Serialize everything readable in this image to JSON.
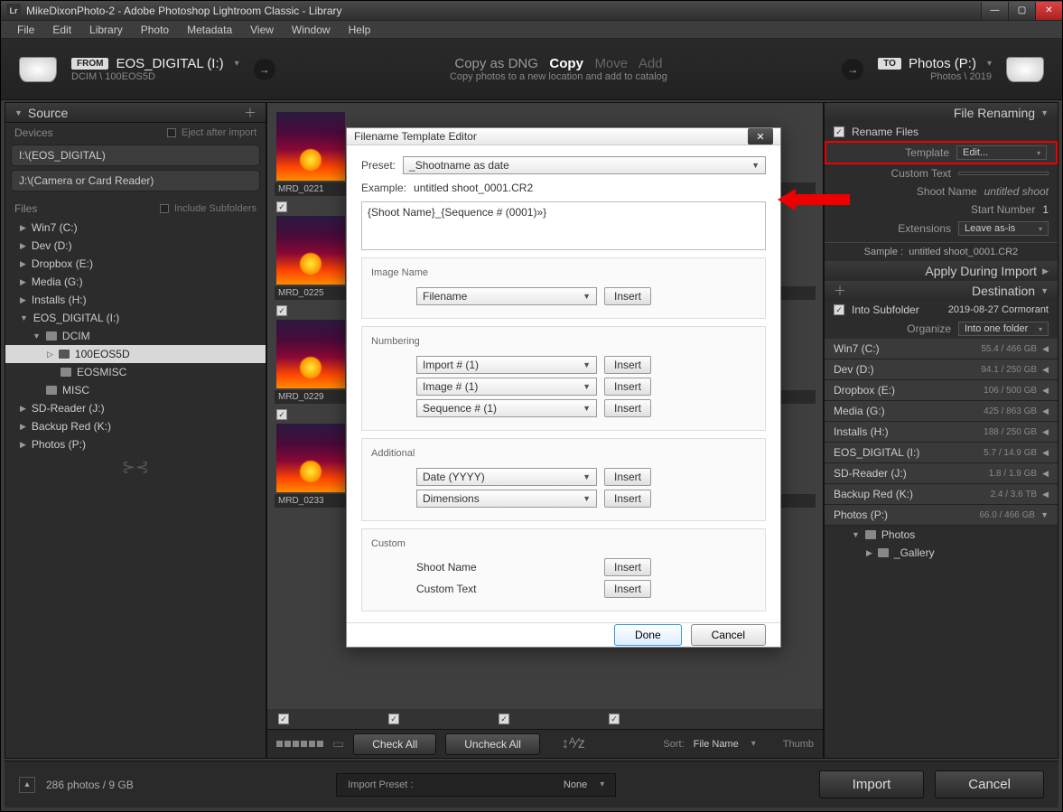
{
  "window": {
    "title": "MikeDixonPhoto-2 - Adobe Photoshop Lightroom Classic - Library",
    "icon_label": "Lr"
  },
  "menu": [
    "File",
    "Edit",
    "Library",
    "Photo",
    "Metadata",
    "View",
    "Window",
    "Help"
  ],
  "importbar": {
    "from_badge": "FROM",
    "from_main": "EOS_DIGITAL (I:)",
    "from_sub": "DCIM \\ 100EOS5D",
    "modes": {
      "dng": "Copy as DNG",
      "copy": "Copy",
      "move": "Move",
      "add": "Add"
    },
    "sub": "Copy photos to a new location and add to catalog",
    "to_badge": "TO",
    "to_main": "Photos (P:)",
    "to_sub": "Photos \\ 2019"
  },
  "source": {
    "header": "Source",
    "devices_label": "Devices",
    "eject": "Eject after import",
    "device_rows": [
      "I:\\(EOS_DIGITAL)",
      "J:\\(Camera or Card Reader)"
    ],
    "files_label": "Files",
    "include_sub": "Include Subfolders",
    "drives": [
      "Win7 (C:)",
      "Dev (D:)",
      "Dropbox (E:)",
      "Media (G:)",
      "Installs (H:)"
    ],
    "eos_label": "EOS_DIGITAL (I:)",
    "dcim": "DCIM",
    "eos5d": "100EOS5D",
    "eosmisc": "EOSMISC",
    "misc": "MISC",
    "more": [
      "SD-Reader (J:)",
      "Backup Red (K:)",
      "Photos (P:)"
    ]
  },
  "thumbs": [
    "MRD_0221",
    "MRD_0225",
    "MRD_0229",
    "MRD_0233"
  ],
  "toolbar": {
    "check_all": "Check All",
    "uncheck_all": "Uncheck All",
    "sort_label": "Sort:",
    "sort_value": "File Name",
    "thumb": "Thumb"
  },
  "right": {
    "rename_header": "File Renaming",
    "rename_check": "Rename Files",
    "template_label": "Template",
    "template_value": "Edit...",
    "custom_text_label": "Custom Text",
    "shoot_name_label": "Shoot Name",
    "shoot_name_value": "untitled shoot",
    "start_num_label": "Start Number",
    "start_num_value": "1",
    "ext_label": "Extensions",
    "ext_value": "Leave as-is",
    "sample_label": "Sample :",
    "sample_value": "untitled shoot_0001.CR2",
    "apply_header": "Apply During Import",
    "dest_header": "Destination",
    "subfolder_check": "Into Subfolder",
    "subfolder_value": "2019-08-27 Cormorant",
    "organize_label": "Organize",
    "organize_value": "Into one folder",
    "drives": [
      {
        "name": "Win7 (C:)",
        "space": "55.4 / 466 GB"
      },
      {
        "name": "Dev (D:)",
        "space": "94.1 / 250 GB"
      },
      {
        "name": "Dropbox (E:)",
        "space": "106 / 500 GB"
      },
      {
        "name": "Media (G:)",
        "space": "425 / 863 GB"
      },
      {
        "name": "Installs (H:)",
        "space": "188 / 250 GB"
      },
      {
        "name": "EOS_DIGITAL (I:)",
        "space": "5.7 / 14.9 GB"
      },
      {
        "name": "SD-Reader (J:)",
        "space": "1.8 / 1.9 GB"
      },
      {
        "name": "Backup Red (K:)",
        "space": "2.4 / 3.6 TB"
      },
      {
        "name": "Photos (P:)",
        "space": "66.0 / 466 GB"
      }
    ],
    "photos_sub": "Photos",
    "gallery": "_Gallery"
  },
  "bottom": {
    "status": "286 photos / 9 GB",
    "preset_label": "Import Preset :",
    "preset_value": "None",
    "import": "Import",
    "cancel": "Cancel"
  },
  "dialog": {
    "title": "Filename Template Editor",
    "preset_label": "Preset:",
    "preset_value": "_Shootname as date",
    "example_label": "Example:",
    "example_value": "untitled shoot_0001.CR2",
    "token": "{Shoot Name}_{Sequence # (0001)»}",
    "image_name": "Image Name",
    "filename": "Filename",
    "numbering": "Numbering",
    "import_num": "Import # (1)",
    "image_num": "Image # (1)",
    "seq_num": "Sequence # (1)",
    "additional": "Additional",
    "date": "Date (YYYY)",
    "dimensions": "Dimensions",
    "custom": "Custom",
    "shoot_name": "Shoot Name",
    "custom_text": "Custom Text",
    "insert": "Insert",
    "done": "Done",
    "cancel": "Cancel"
  }
}
